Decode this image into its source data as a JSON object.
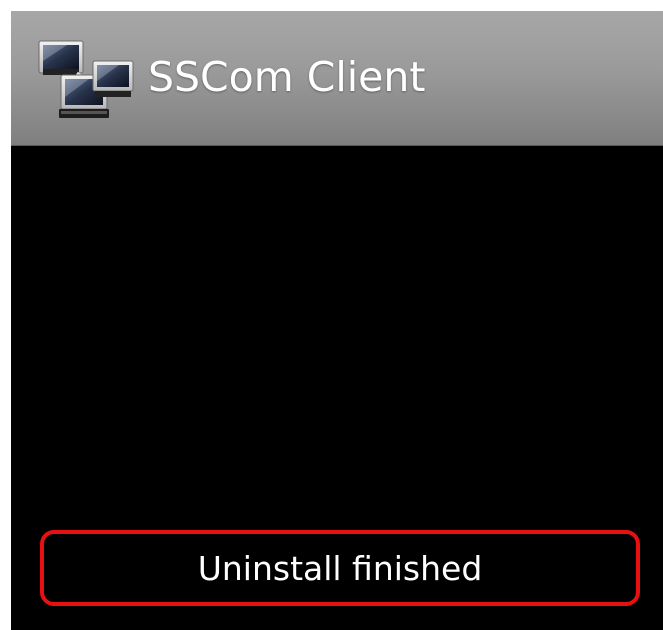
{
  "app": {
    "title": "SSCom Client",
    "icon": "network-computers-icon"
  },
  "toast": {
    "message": "Uninstall finished",
    "highlight_color": "#e81010"
  },
  "colors": {
    "screen_background": "#000000",
    "title_bar": "#9a9a9a",
    "text": "#ffffff"
  }
}
